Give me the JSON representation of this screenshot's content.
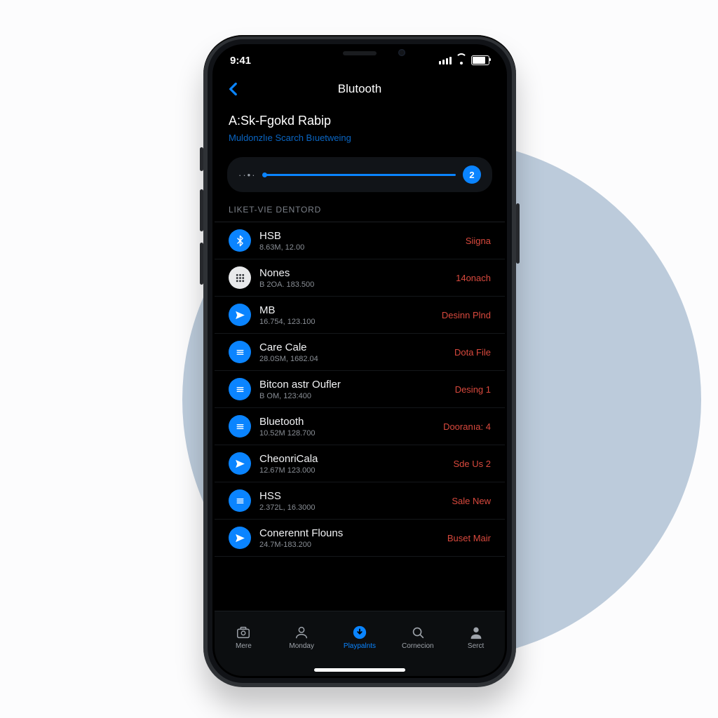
{
  "status": {
    "time": "9:41"
  },
  "nav": {
    "title": "Blutooth"
  },
  "header": {
    "title": "A:Sk-Fgokd Rabip",
    "subtitle": "Muldonzlıe Scarch Bıuetweing"
  },
  "slider": {
    "dots": "··•·",
    "value": "2"
  },
  "section": {
    "label": "LIKET-VIE DENTORD"
  },
  "devices": [
    {
      "name": "HSB",
      "meta": "8.63M, 12.00",
      "tag": "Siigna"
    },
    {
      "name": "Nones",
      "meta": "B 2OA. 183.500",
      "tag": "14onach"
    },
    {
      "name": "MB",
      "meta": "16.754, 123.100",
      "tag": "Desinn Plnd"
    },
    {
      "name": "Care Cale",
      "meta": "28.0SM, 1682.04",
      "tag": "Dota File"
    },
    {
      "name": "Bitcon astr Oufler",
      "meta": "B OM, 123:400",
      "tag": "Desing 1"
    },
    {
      "name": "Bluetooth",
      "meta": "10.52M 128.700",
      "tag": "Dooranıa: 4"
    },
    {
      "name": "CheonriCala",
      "meta": "12.67M 123.000",
      "tag": "Sde Us 2"
    },
    {
      "name": "HSS",
      "meta": "2.372L, 16.3000",
      "tag": "Sale New"
    },
    {
      "name": "Conerennt Flouns",
      "meta": "24.7M-183.200",
      "tag": "Buset Mair"
    }
  ],
  "tabs": [
    {
      "label": "Mere"
    },
    {
      "label": "Monday"
    },
    {
      "label": "Playpalnts"
    },
    {
      "label": "Cornecion"
    },
    {
      "label": "Serct"
    }
  ]
}
